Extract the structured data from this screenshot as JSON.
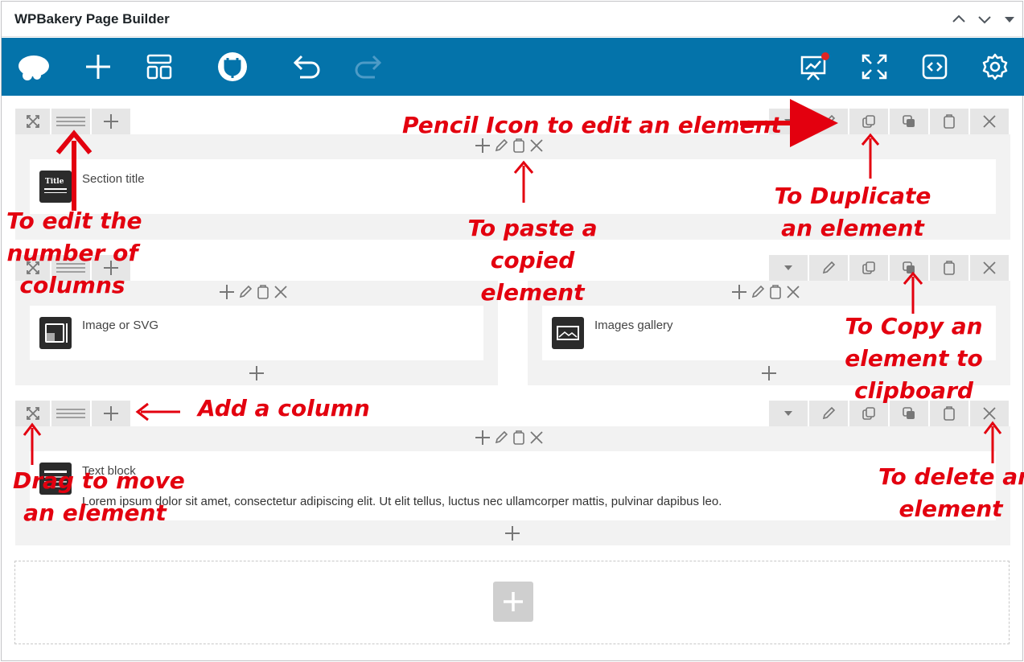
{
  "panel": {
    "title": "WPBakery Page Builder"
  },
  "rows": [
    {
      "element_name": "Section title",
      "icon_label": "Title"
    },
    {
      "columns": [
        {
          "element_name": "Image or SVG"
        },
        {
          "element_name": "Images gallery"
        }
      ]
    },
    {
      "element_name": "Text block",
      "element_text": "Lorem ipsum dolor sit amet, consectetur adipiscing elit. Ut elit tellus, luctus nec ullamcorper mattis, pulvinar dapibus leo."
    }
  ],
  "annotations": {
    "pencil": "Pencil Icon to edit an element",
    "duplicate_1": "To Duplicate",
    "duplicate_2": "an element",
    "columns_1": "To edit the",
    "columns_2": "number of",
    "columns_3": "columns",
    "paste_1": "To paste a",
    "paste_2": "copied",
    "paste_3": "element",
    "copy_1": "To Copy an",
    "copy_2": "element to",
    "copy_3": "clipboard",
    "add_column": "Add a column",
    "drag_1": "Drag to move",
    "drag_2": "an element",
    "delete_1": "To delete an",
    "delete_2": "element"
  },
  "colors": {
    "toolbar_bg": "#0473aa",
    "annotation": "#e3000f",
    "notification_dot": "#e02424"
  },
  "icons": {
    "toolbar": [
      "cloud-icon",
      "plus-icon",
      "layout-icon",
      "plugin-icon",
      "undo-icon",
      "redo-icon",
      "preview-icon",
      "fullscreen-icon",
      "code-icon",
      "gear-icon"
    ]
  }
}
